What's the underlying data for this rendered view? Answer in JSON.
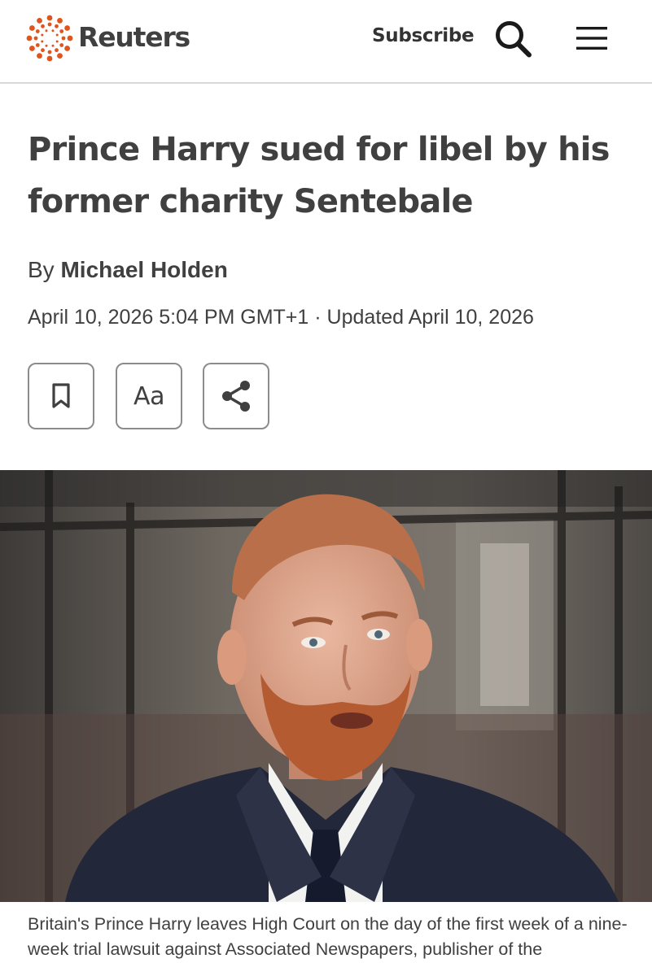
{
  "header": {
    "brand": "Reuters",
    "subscribe_label": "Subscribe",
    "logo_icon": "reuters-dot-ring-logo",
    "search_icon": "search-icon",
    "menu_icon": "hamburger-menu-icon",
    "logo_color": "#e0541e"
  },
  "article": {
    "headline": "Prince Harry sued for libel by his former charity Sentebale",
    "byline_prefix": "By",
    "author": "Michael Holden",
    "published": "April 10, 2026 5:04 PM GMT+1",
    "separator": "·",
    "updated": "Updated April 10, 2026",
    "tools": {
      "bookmark_icon": "bookmark-icon",
      "text_size_label": "Aa",
      "share_icon": "share-icon"
    },
    "caption": "Britain's Prince Harry leaves High Court on the day of the first week of a nine-week trial lawsuit against Associated Newspapers, publisher of the"
  }
}
